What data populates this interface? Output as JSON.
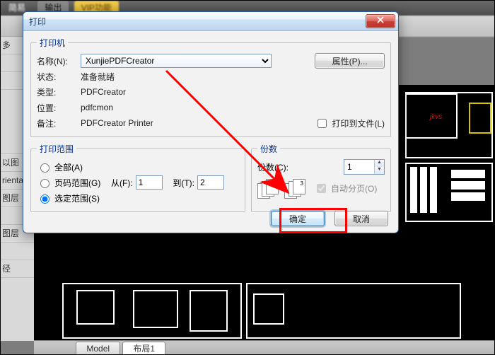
{
  "bg": {
    "ribbon_tabs": [
      "简易",
      "输出",
      "VIP功能"
    ],
    "side_rows": [
      "多",
      "",
      "",
      "",
      "以图",
      "rientat",
      "图层",
      "",
      "图层",
      "",
      "径"
    ],
    "bottom_tabs": {
      "model": "Model",
      "layout1": "布局1"
    }
  },
  "dialog": {
    "title": "打印",
    "printer": {
      "legend": "打印机",
      "name_label": "名称(N):",
      "name_value": "XunjiePDFCreator",
      "status_label": "状态:",
      "status_value": "准备就绪",
      "type_label": "类型:",
      "type_value": "PDFCreator",
      "where_label": "位置:",
      "where_value": "pdfcmon",
      "comment_label": "备注:",
      "comment_value": "PDFCreator Printer",
      "properties_btn": "属性(P)...",
      "print_to_file": "打印到文件(L)"
    },
    "range": {
      "legend": "打印范围",
      "all": "全部(A)",
      "pages": "页码范围(G)",
      "from_label": "从(F):",
      "from_value": "1",
      "to_label": "到(T):",
      "to_value": "2",
      "selection": "选定范围(S)"
    },
    "copies": {
      "legend": "份数",
      "count_label": "份数(C):",
      "count_value": "1",
      "collate": "自动分页(O)"
    },
    "actions": {
      "ok": "确定",
      "cancel": "取消"
    }
  }
}
